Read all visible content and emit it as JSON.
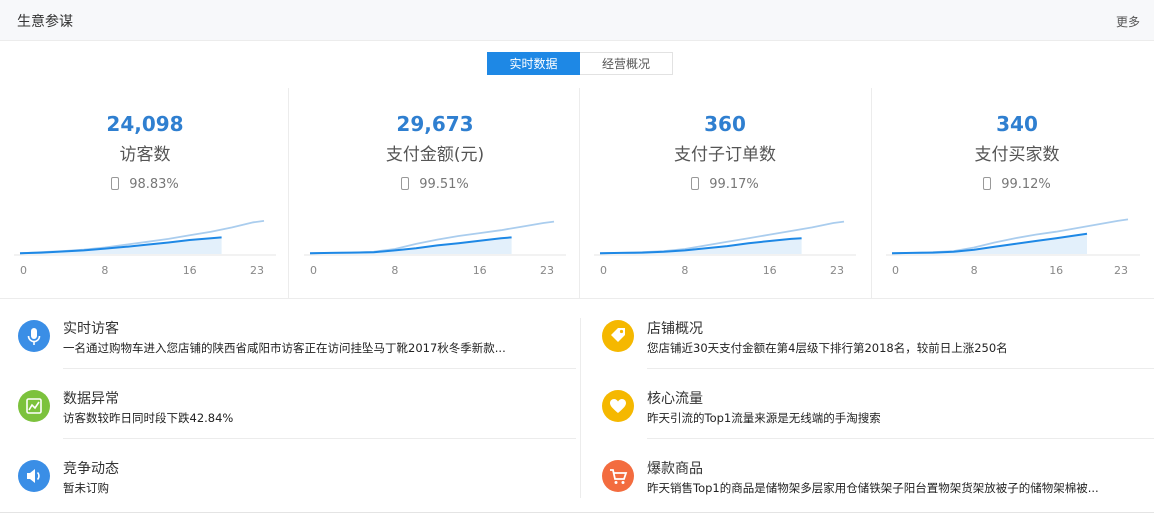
{
  "header": {
    "title": "生意参谋",
    "more": "更多"
  },
  "tabs": [
    {
      "label": "实时数据",
      "active": true
    },
    {
      "label": "经营概况",
      "active": false
    }
  ],
  "metrics": [
    {
      "value": "24,098",
      "label": "访客数",
      "pct": "98.83%",
      "chart_data": {
        "type": "line",
        "x_ticks": [
          "0",
          "8",
          "16",
          "23"
        ],
        "xlim": [
          0,
          23
        ],
        "series": [
          {
            "color": "#aacdee",
            "x": [
              0,
              2,
              4,
              6,
              8,
              10,
              12,
              14,
              16,
              18,
              20,
              22,
              23
            ],
            "y": [
              0.02,
              0.05,
              0.08,
              0.12,
              0.18,
              0.26,
              0.34,
              0.42,
              0.52,
              0.62,
              0.74,
              0.88,
              0.92
            ]
          },
          {
            "color": "#1e88e5",
            "x": [
              0,
              2,
              4,
              6,
              8,
              10,
              12,
              14,
              16,
              18,
              19
            ],
            "y": [
              0.02,
              0.04,
              0.07,
              0.1,
              0.15,
              0.2,
              0.26,
              0.32,
              0.39,
              0.44,
              0.46
            ]
          }
        ]
      }
    },
    {
      "value": "29,673",
      "label": "支付金额(元)",
      "pct": "99.51%",
      "chart_data": {
        "type": "line",
        "x_ticks": [
          "0",
          "8",
          "16",
          "23"
        ],
        "xlim": [
          0,
          23
        ],
        "series": [
          {
            "color": "#aacdee",
            "x": [
              0,
              2,
              4,
              6,
              8,
              10,
              12,
              14,
              16,
              18,
              20,
              22,
              23
            ],
            "y": [
              0.02,
              0.03,
              0.04,
              0.06,
              0.14,
              0.28,
              0.4,
              0.5,
              0.58,
              0.66,
              0.76,
              0.86,
              0.9
            ]
          },
          {
            "color": "#1e88e5",
            "x": [
              0,
              2,
              4,
              6,
              8,
              10,
              12,
              14,
              16,
              18,
              19
            ],
            "y": [
              0.02,
              0.03,
              0.04,
              0.05,
              0.1,
              0.16,
              0.24,
              0.3,
              0.37,
              0.44,
              0.46
            ]
          }
        ]
      }
    },
    {
      "value": "360",
      "label": "支付子订单数",
      "pct": "99.17%",
      "chart_data": {
        "type": "line",
        "x_ticks": [
          "0",
          "8",
          "16",
          "23"
        ],
        "xlim": [
          0,
          23
        ],
        "series": [
          {
            "color": "#aacdee",
            "x": [
              0,
              2,
              4,
              6,
              8,
              10,
              12,
              14,
              16,
              18,
              20,
              22,
              23
            ],
            "y": [
              0.02,
              0.03,
              0.05,
              0.08,
              0.14,
              0.24,
              0.34,
              0.44,
              0.54,
              0.64,
              0.74,
              0.86,
              0.9
            ]
          },
          {
            "color": "#1e88e5",
            "x": [
              0,
              2,
              4,
              6,
              8,
              10,
              12,
              14,
              16,
              18,
              19
            ],
            "y": [
              0.02,
              0.03,
              0.04,
              0.06,
              0.1,
              0.16,
              0.22,
              0.3,
              0.36,
              0.42,
              0.44
            ]
          }
        ]
      }
    },
    {
      "value": "340",
      "label": "支付买家数",
      "pct": "99.12%",
      "chart_data": {
        "type": "line",
        "x_ticks": [
          "0",
          "8",
          "16",
          "23"
        ],
        "xlim": [
          0,
          23
        ],
        "series": [
          {
            "color": "#aacdee",
            "x": [
              0,
              2,
              4,
              6,
              8,
              10,
              12,
              14,
              16,
              18,
              20,
              22,
              23
            ],
            "y": [
              0.02,
              0.03,
              0.05,
              0.08,
              0.18,
              0.32,
              0.44,
              0.54,
              0.62,
              0.72,
              0.82,
              0.92,
              0.96
            ]
          },
          {
            "color": "#1e88e5",
            "x": [
              0,
              2,
              4,
              6,
              8,
              10,
              12,
              14,
              16,
              18,
              19
            ],
            "y": [
              0.02,
              0.03,
              0.04,
              0.06,
              0.12,
              0.2,
              0.28,
              0.36,
              0.44,
              0.52,
              0.56
            ]
          }
        ]
      }
    }
  ],
  "feeds": [
    {
      "title": "实时访客",
      "desc": "一名通过购物车进入您店铺的陕西省咸阳市访客正在访问挂坠马丁靴2017秋冬季新款...",
      "icon": "microphone-icon",
      "color": "#3a8ee6"
    },
    {
      "title": "店铺概况",
      "desc": "您店铺近30天支付金额在第4层级下排行第2018名，较前日上涨250名",
      "icon": "tag-icon",
      "color": "#f5b800"
    },
    {
      "title": "数据异常",
      "desc": "访客数较昨日同时段下跌42.84%",
      "icon": "chart-icon",
      "color": "#7cc23d"
    },
    {
      "title": "核心流量",
      "desc": "昨天引流的Top1流量来源是无线端的手淘搜索",
      "icon": "heart-icon",
      "color": "#f5b800"
    },
    {
      "title": "竞争动态",
      "desc": "暂未订购",
      "icon": "speaker-icon",
      "color": "#3a8ee6"
    },
    {
      "title": "爆款商品",
      "desc": "昨天销售Top1的商品是储物架多层家用仓储铁架子阳台置物架货架放被子的储物架棉被...",
      "icon": "cart-icon",
      "color": "#f36c3f"
    }
  ]
}
